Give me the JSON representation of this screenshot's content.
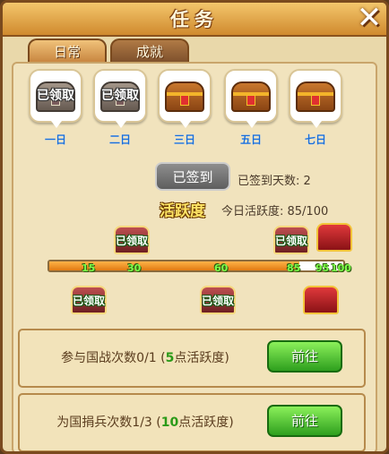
{
  "window": {
    "title": "任务",
    "close_label": "✕"
  },
  "tabs": [
    {
      "label": "日常",
      "active": true
    },
    {
      "label": "成就",
      "active": false
    }
  ],
  "sign_in": {
    "days": [
      {
        "label": "一日",
        "status": "已领取"
      },
      {
        "label": "二日",
        "status": "已领取"
      },
      {
        "label": "三日",
        "status": ""
      },
      {
        "label": "五日",
        "status": ""
      },
      {
        "label": "七日",
        "status": ""
      }
    ],
    "button_label": "已签到",
    "signed_days_text": "已签到天数: 2"
  },
  "activity": {
    "title": "活跃度",
    "today_text": "今日活跃度: 85/100",
    "progress": 85,
    "max": 100,
    "milestones": [
      {
        "value": "15",
        "claimed": true,
        "status": "已领取"
      },
      {
        "value": "30",
        "claimed": true,
        "status": "已领取"
      },
      {
        "value": "60",
        "claimed": true,
        "status": "已领取"
      },
      {
        "value": "85",
        "claimed": true,
        "status": "已领取"
      },
      {
        "value": "95",
        "claimed": false,
        "status": ""
      },
      {
        "value": "100",
        "claimed": false,
        "status": ""
      }
    ]
  },
  "tasks": [
    {
      "prefix": "参与国战次数0/1 (",
      "points": "5",
      "suffix": "点活跃度)",
      "button": "前往"
    },
    {
      "prefix": "为国捐兵次数1/3 (",
      "points": "10",
      "suffix": "点活跃度)",
      "button": "前往"
    }
  ],
  "colors": {
    "accent_green": "#2e9f1e",
    "bar_orange": "#e07a12",
    "day_blue": "#1a6fd8"
  }
}
